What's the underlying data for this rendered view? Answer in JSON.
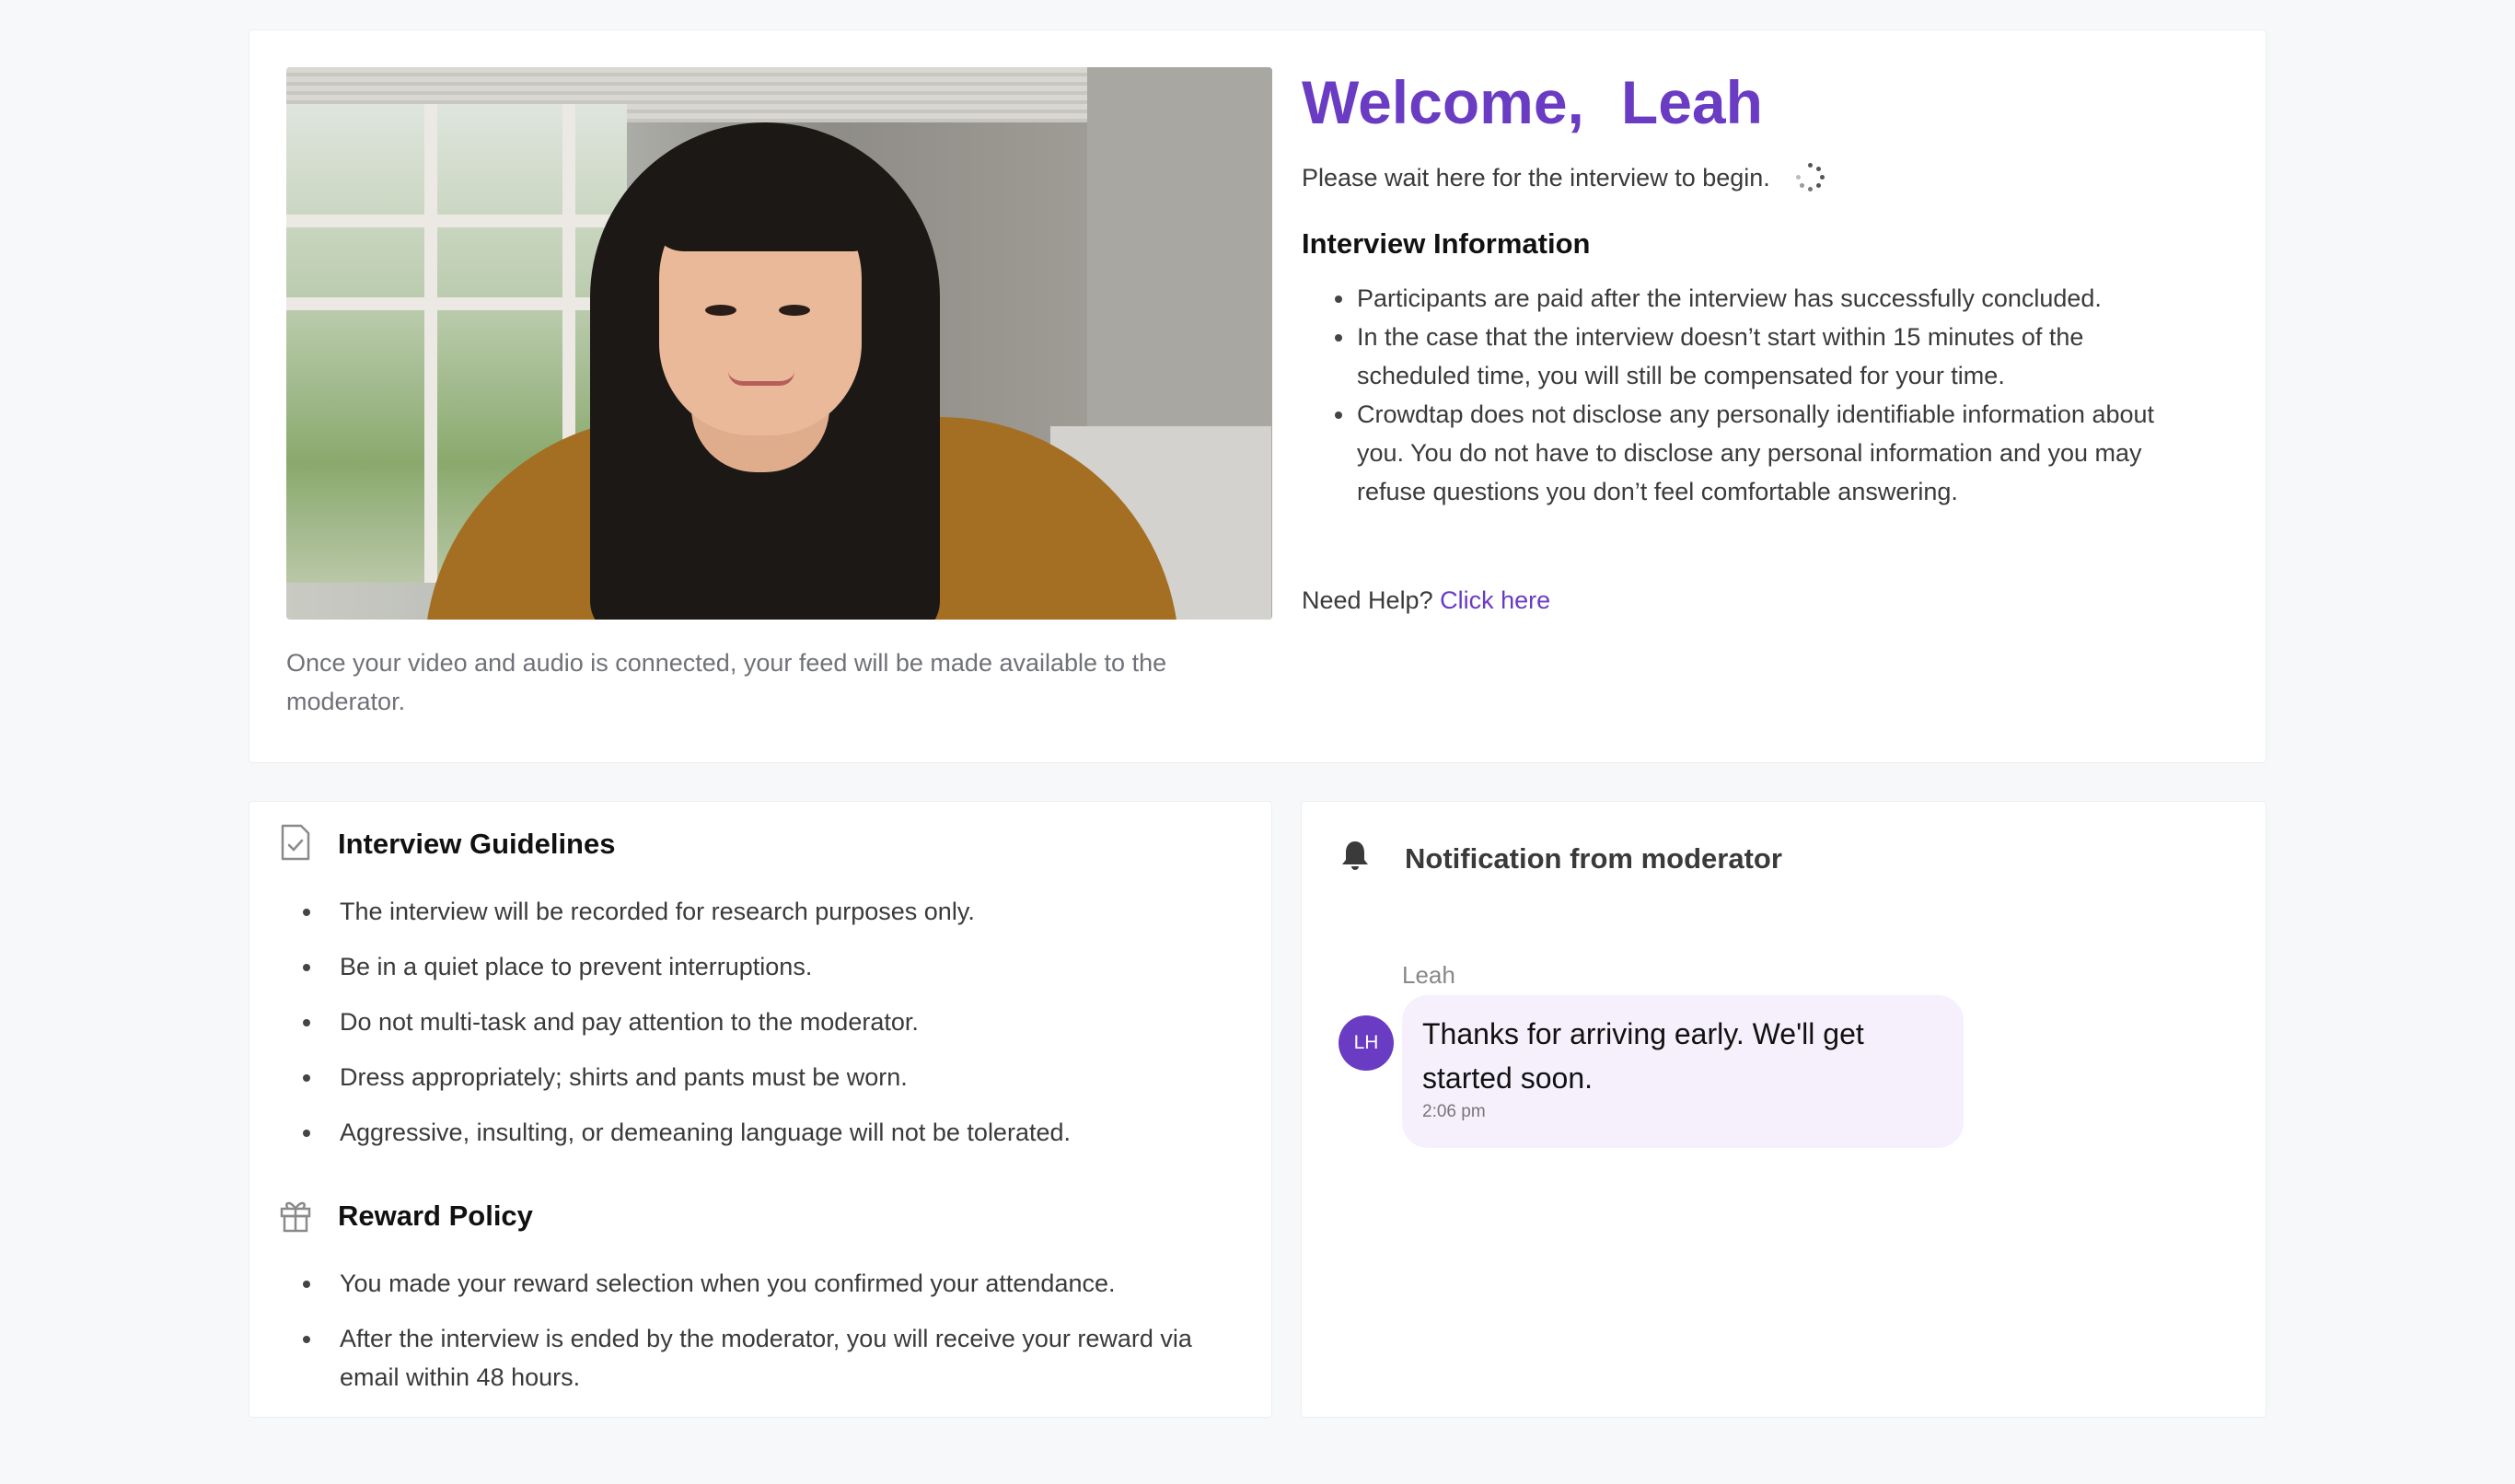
{
  "welcome": {
    "greeting": "Welcome,",
    "name": "Leah"
  },
  "wait_message": "Please wait here for the interview to begin.",
  "video": {
    "caption": "Once your video and audio is connected, your feed will be made available to the moderator."
  },
  "interview_info": {
    "title": "Interview Information",
    "items": [
      "Participants are paid after the interview has successfully concluded.",
      "In the case that the interview doesn’t start within 15 minutes of the scheduled time, you will still be compensated for your time.",
      "Crowdtap does not disclose any personally identifiable information about you. You do not have to disclose any personal information and you may refuse questions you don’t feel comfortable answering."
    ]
  },
  "help": {
    "prefix": "Need Help?",
    "link_label": "Click here"
  },
  "guidelines": {
    "title": "Interview Guidelines",
    "items": [
      "The interview will be recorded for research purposes only.",
      "Be in a quiet place to prevent interruptions.",
      "Do not multi-task and pay attention to the moderator.",
      "Dress appropriately; shirts and pants must be worn.",
      "Aggressive, insulting, or demeaning language will not be tolerated."
    ]
  },
  "reward_policy": {
    "title": "Reward Policy",
    "items": [
      "You made your reward selection when you confirmed your attendance.",
      "After the interview is ended by the moderator, you will receive your reward via email within 48 hours."
    ]
  },
  "notification": {
    "title": "Notification from moderator",
    "sender": "Leah",
    "avatar_initials": "LH",
    "message": "Thanks for arriving early. We'll get started soon.",
    "time": "2:06 pm"
  },
  "colors": {
    "accent": "#6a3bc3",
    "bubble": "#f6f0fd",
    "background": "#f7f8fa"
  },
  "icons": [
    "loading-spinner-icon",
    "checklist-document-icon",
    "gift-icon",
    "bell-icon"
  ]
}
